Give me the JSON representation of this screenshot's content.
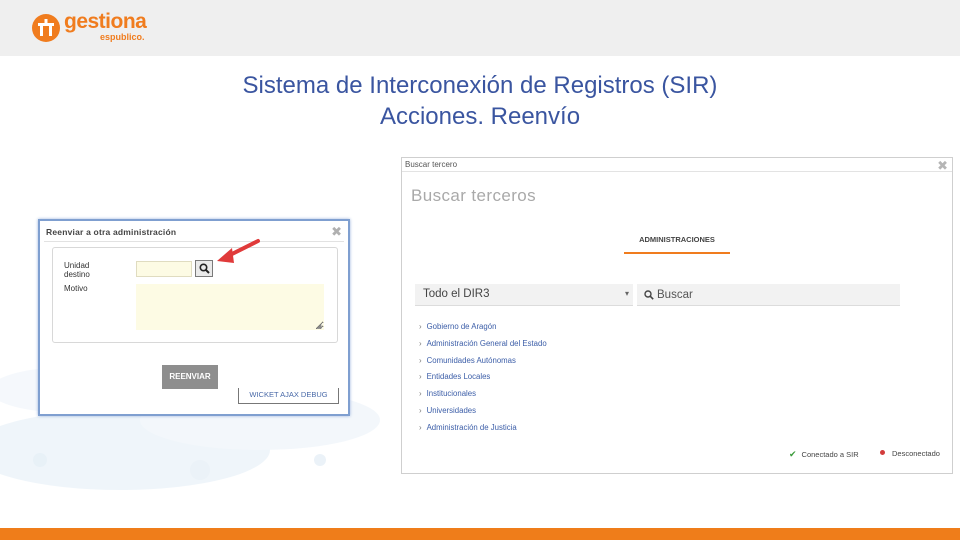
{
  "brand": {
    "name": "gestiona",
    "sub": "espublico."
  },
  "title": {
    "line1": "Sistema de Interconexión de Registros (SIR)",
    "line2": "Acciones. Reenvío"
  },
  "reenviar_dialog": {
    "title": "Reenviar a otra administración",
    "close": "✖",
    "unidad_label": "Unidad destino",
    "unidad_value": "",
    "motivo_label": "Motivo",
    "motivo_value": "",
    "submit_label": "REENVIAR",
    "debug_label": "WICKET AJAX DEBUG"
  },
  "buscar_dialog": {
    "window_title": "Buscar tercero",
    "close": "✖",
    "heading": "Buscar terceros",
    "tab": "ADMINISTRACIONES",
    "select_value": "Todo el DIR3",
    "search_placeholder": "Buscar",
    "items": [
      "Gobierno de Aragón",
      "Administración General del Estado",
      "Comunidades Autónomas",
      "Entidades Locales",
      "Institucionales",
      "Universidades",
      "Administración de Justicia"
    ],
    "status_connected": "Conectado a SIR",
    "status_disconnected": "Desconectado"
  },
  "colors": {
    "brand_orange": "#f07c1e",
    "title_blue": "#3a55a0",
    "arrow_red": "#e03a3a",
    "connected_green": "#3b9b3b",
    "disconnected_red": "#d23b3b"
  }
}
